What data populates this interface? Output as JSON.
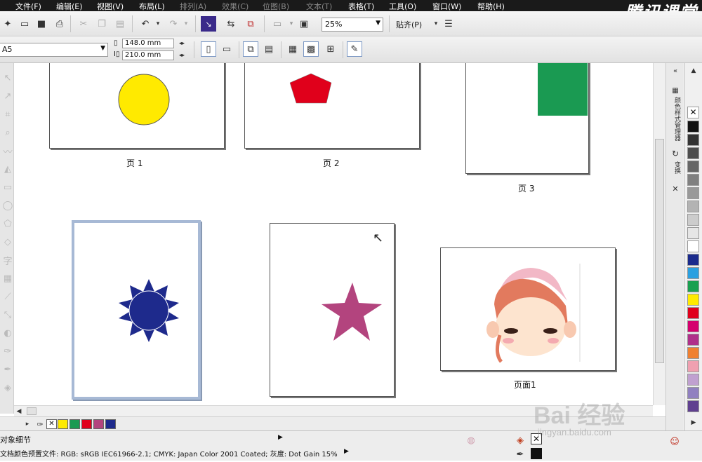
{
  "menubar": {
    "items": [
      "文件(F)",
      "编辑(E)",
      "视图(V)",
      "布局(L)",
      "排列(A)",
      "效果(C)",
      "位图(B)",
      "文本(T)",
      "表格(T)",
      "工具(O)",
      "窗口(W)",
      "帮助(H)"
    ],
    "brand": "腾讯课堂"
  },
  "toolbar1": {
    "zoom": "25%",
    "snap_label": "贴齐(P)"
  },
  "toolbar2": {
    "page_size": "A5",
    "width": "148.0 mm",
    "height": "210.0 mm"
  },
  "pages": {
    "p1_label": "页 1",
    "p2_label": "页 2",
    "p3_label": "页 3",
    "p4_label": "页面1"
  },
  "shapes": {
    "circle_color": "#ffea00",
    "pentagon_color": "#e0001b",
    "rect_color": "#1a9a52",
    "sun_color": "#1e2a8c",
    "star_color": "#b3447e"
  },
  "docker": {
    "tab1": "颜色样式管理器",
    "tab2": "变换"
  },
  "palette": {
    "colors": [
      "#111111",
      "#333333",
      "#4d4d4d",
      "#666666",
      "#808080",
      "#999999",
      "#b3b3b3",
      "#cccccc",
      "#e6e6e6",
      "#ffffff",
      "#1a2a8c",
      "#2aa0e0",
      "#1aa050",
      "#ffea00",
      "#e0001b",
      "#d4006e",
      "#b0308a",
      "#f08030",
      "#f0a0b0",
      "#c0a0d0",
      "#9080c0",
      "#604090"
    ]
  },
  "docbar": {
    "colors": [
      "#ffea00",
      "#1a9a52",
      "#e0001b",
      "#b3447e",
      "#1e2a8c"
    ]
  },
  "status": {
    "object_details": "对象细节",
    "color_profile": "文档颜色预置文件: RGB: sRGB IEC61966-2.1; CMYK: Japan Color 2001 Coated; 灰度: Dot Gain 15%"
  },
  "watermark": {
    "main": "Bai 经验",
    "sub": "jingyan.baidu.com"
  }
}
